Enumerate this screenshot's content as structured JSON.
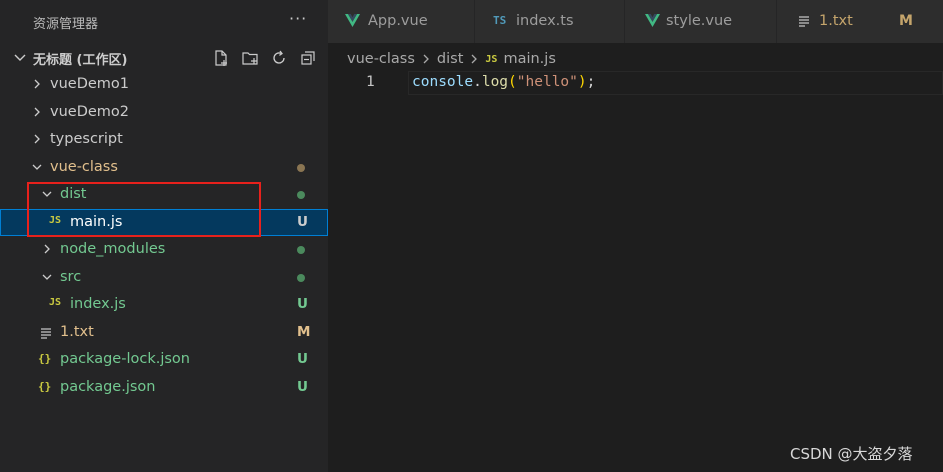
{
  "sidebar": {
    "title": "资源管理器",
    "more_label": "···",
    "workspace": {
      "label": "无标题 (工作区)",
      "actions": [
        "new-file-icon",
        "new-folder-icon",
        "refresh-icon",
        "collapse-all-icon"
      ]
    },
    "tree": [
      {
        "label": "vueDemo1",
        "kind": "folder",
        "expanded": false,
        "depth": 0,
        "status": ""
      },
      {
        "label": "vueDemo2",
        "kind": "folder",
        "expanded": false,
        "depth": 0,
        "status": ""
      },
      {
        "label": "typescript",
        "kind": "folder",
        "expanded": false,
        "depth": 0,
        "status": ""
      },
      {
        "label": "vue-class",
        "kind": "folder",
        "expanded": true,
        "depth": 0,
        "status": "dot-modified"
      },
      {
        "label": "dist",
        "kind": "folder",
        "expanded": true,
        "depth": 1,
        "status": "dot-untracked"
      },
      {
        "label": "main.js",
        "kind": "js",
        "depth": 2,
        "status": "U",
        "selected": true
      },
      {
        "label": "node_modules",
        "kind": "folder",
        "expanded": false,
        "depth": 1,
        "status": "dot-untracked"
      },
      {
        "label": "src",
        "kind": "folder",
        "expanded": true,
        "depth": 1,
        "status": "dot-untracked"
      },
      {
        "label": "index.js",
        "kind": "js",
        "depth": 2,
        "status": "U"
      },
      {
        "label": "1.txt",
        "kind": "txt",
        "depth": 1,
        "status": "M"
      },
      {
        "label": "package-lock.json",
        "kind": "json",
        "depth": 1,
        "status": "U"
      },
      {
        "label": "package.json",
        "kind": "json",
        "depth": 1,
        "status": "U"
      }
    ]
  },
  "tabs": [
    {
      "label": "App.vue",
      "icon": "vue-icon",
      "badge": ""
    },
    {
      "label": "index.ts",
      "icon": "ts-icon",
      "icon_text": "TS",
      "badge": ""
    },
    {
      "label": "style.vue",
      "icon": "vue-icon",
      "badge": ""
    },
    {
      "label": "1.txt",
      "icon": "txt-icon",
      "badge": "M"
    }
  ],
  "breadcrumb": {
    "items": [
      "vue-class",
      "dist",
      "main.js"
    ],
    "file_icon_text": "JS"
  },
  "editor": {
    "line_number": "1",
    "code_tokens": {
      "obj": "console",
      "dot": ".",
      "fn": "log",
      "open": "(",
      "str": "\"hello\"",
      "close": ")",
      "semi": ";"
    }
  },
  "icon_texts": {
    "js": "JS",
    "json": "{}"
  },
  "watermark": "CSDN @大盗夕落",
  "colors": {
    "sidebar_bg": "#252526",
    "editor_bg": "#1e1e1e",
    "selection_bg": "#04395e",
    "selection_border": "#007fd4",
    "untracked_green": "#73c991",
    "modified_amber": "#e2c08d",
    "annotation_red": "#e8211c"
  }
}
